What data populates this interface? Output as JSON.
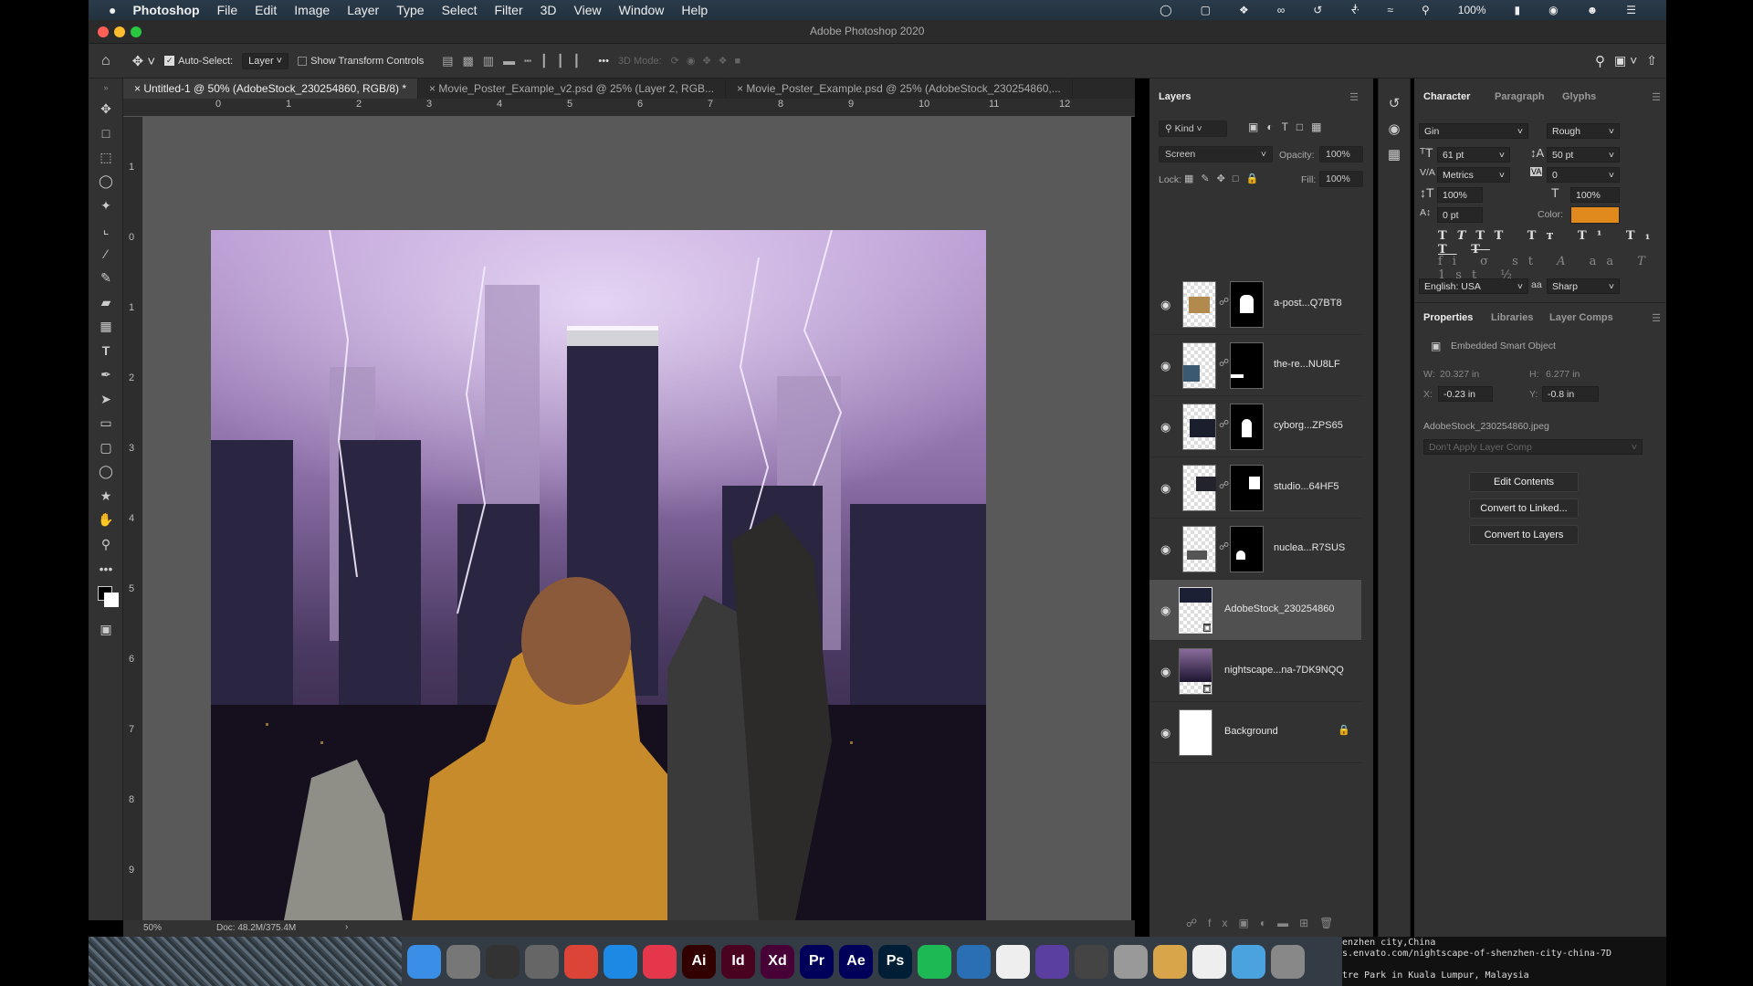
{
  "menubar": {
    "apple": "",
    "app": "Photoshop",
    "items": [
      "File",
      "Edit",
      "Image",
      "Layer",
      "Type",
      "Select",
      "Filter",
      "3D",
      "View",
      "Window",
      "Help"
    ],
    "battery": "100%"
  },
  "titlebar": {
    "title": "Adobe Photoshop 2020"
  },
  "options": {
    "auto_select_label": "Auto-Select:",
    "auto_select_checked": true,
    "auto_select_value": "Layer",
    "show_transform_label": "Show Transform Controls",
    "mode_3d": "3D Mode:"
  },
  "tabs": [
    {
      "label": "Untitled-1 @ 50% (AdobeStock_230254860, RGB/8) *",
      "active": true
    },
    {
      "label": "Movie_Poster_Example_v2.psd @ 25% (Layer 2, RGB...",
      "active": false
    },
    {
      "label": "Movie_Poster_Example.psd @ 25% (AdobeStock_230254860,...",
      "active": false
    }
  ],
  "ruler": {
    "top": [
      "0",
      "1",
      "2",
      "3",
      "4",
      "5",
      "6",
      "7",
      "8",
      "9",
      "10",
      "11",
      "12"
    ],
    "left": [
      "1",
      "0",
      "1",
      "2",
      "3",
      "4",
      "5",
      "6",
      "7",
      "8",
      "9"
    ]
  },
  "status": {
    "zoom": "50%",
    "doc": "Doc: 48.2M/375.4M"
  },
  "layers": {
    "tab": "Layers",
    "filter": "Kind",
    "blend_mode": "Screen",
    "opacity_label": "Opacity:",
    "opacity": "100%",
    "lock_label": "Lock:",
    "fill_label": "Fill:",
    "fill": "100%",
    "items": [
      {
        "name": "a-post...Q7BT8",
        "mask": true,
        "visible": true
      },
      {
        "name": "the-re...NU8LF",
        "mask": true,
        "visible": true
      },
      {
        "name": "cyborg...ZPS65",
        "mask": true,
        "visible": true
      },
      {
        "name": "studio...64HF5",
        "mask": true,
        "visible": true
      },
      {
        "name": "nuclea...R7SUS",
        "mask": true,
        "visible": true
      },
      {
        "name": "AdobeStock_230254860",
        "mask": false,
        "visible": true,
        "selected": true
      },
      {
        "name": "nightscape...na-7DK9NQQ",
        "mask": false,
        "visible": true
      },
      {
        "name": "Background",
        "mask": false,
        "visible": true,
        "locked": true
      }
    ]
  },
  "character": {
    "tabs": [
      "Character",
      "Paragraph",
      "Glyphs"
    ],
    "font": "Gin",
    "style": "Rough",
    "size": "61 pt",
    "leading": "50 pt",
    "kerning": "Metrics",
    "tracking": "0",
    "vscale": "100%",
    "hscale": "100%",
    "baseline": "0 pt",
    "color_label": "Color:",
    "color": "#e08a1e",
    "language": "English: USA",
    "antialias": "Sharp",
    "antialias_icon": "aa"
  },
  "properties": {
    "tabs": [
      "Properties",
      "Libraries",
      "Layer Comps"
    ],
    "type": "Embedded Smart Object",
    "w_label": "W:",
    "w": "20.327 in",
    "h_label": "H:",
    "h": "6.277 in",
    "x_label": "X:",
    "x": "-0.23 in",
    "y_label": "Y:",
    "y": "-0.8 in",
    "file": "AdobeStock_230254860.jpeg",
    "layer_comp": "Don't Apply Layer Comp",
    "buttons": [
      "Edit Contents",
      "Convert to Linked...",
      "Convert to Layers"
    ]
  },
  "dock": [
    {
      "name": "finder",
      "label": "",
      "color": "#3a8ee6"
    },
    {
      "name": "launchpad",
      "label": "",
      "color": "#777"
    },
    {
      "name": "activity",
      "label": "",
      "color": "#333"
    },
    {
      "name": "system-preferences",
      "label": "",
      "color": "#666"
    },
    {
      "name": "chrome",
      "label": "",
      "color": "#db4437"
    },
    {
      "name": "safari",
      "label": "",
      "color": "#1e88e5"
    },
    {
      "name": "creative-cloud",
      "label": "",
      "color": "#e5374b"
    },
    {
      "name": "illustrator",
      "label": "Ai",
      "color": "#330000"
    },
    {
      "name": "indesign",
      "label": "Id",
      "color": "#49021f"
    },
    {
      "name": "xd",
      "label": "Xd",
      "color": "#470137"
    },
    {
      "name": "premiere",
      "label": "Pr",
      "color": "#00005b"
    },
    {
      "name": "after-effects",
      "label": "Ae",
      "color": "#00005b"
    },
    {
      "name": "photoshop",
      "label": "Ps",
      "color": "#001e36"
    },
    {
      "name": "spotify",
      "label": "",
      "color": "#1db954"
    },
    {
      "name": "app-a",
      "label": "",
      "color": "#2a6fb3"
    },
    {
      "name": "app-b",
      "label": "",
      "color": "#eee"
    },
    {
      "name": "app-c",
      "label": "",
      "color": "#5b3fa0"
    },
    {
      "name": "app-d",
      "label": "",
      "color": "#444"
    },
    {
      "name": "app-e",
      "label": "",
      "color": "#999"
    },
    {
      "name": "preview",
      "label": "",
      "color": "#d9a54a"
    },
    {
      "name": "textedit",
      "label": "",
      "color": "#eee"
    },
    {
      "name": "downloads",
      "label": "",
      "color": "#4aa3df"
    },
    {
      "name": "trash",
      "label": "",
      "color": "#888"
    }
  ],
  "terminal": [
    "enzhen city,China",
    "s.envato.com/nightscape-of-shenzhen-city-china-7D",
    "",
    "tre Park in Kuala Lumpur, Malaysia"
  ]
}
